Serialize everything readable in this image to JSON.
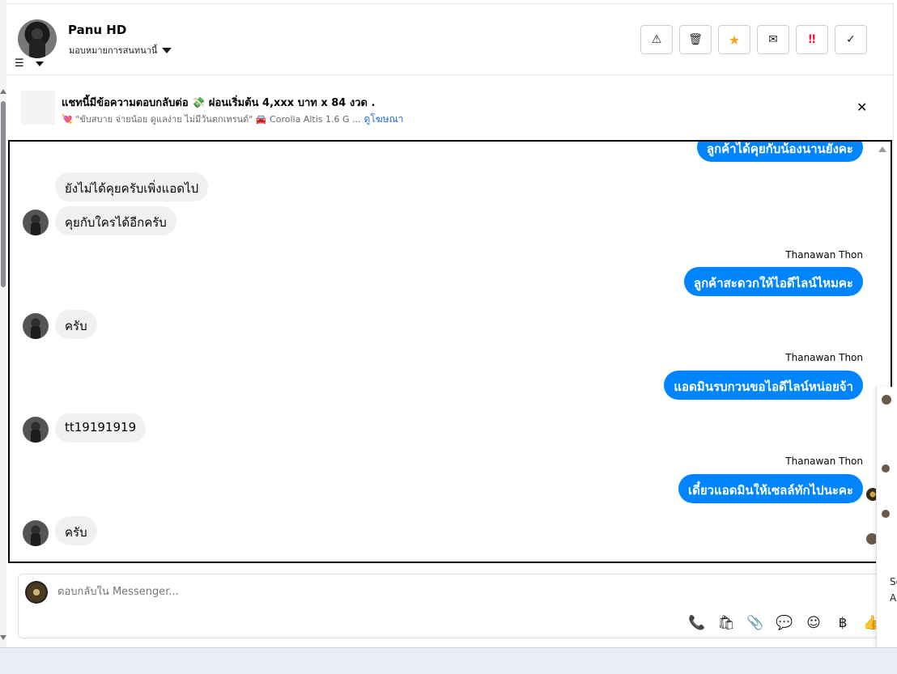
{
  "header": {
    "user_name": "Panu HD",
    "assign_label": "มอบหมายการสนทนานี้",
    "actions": [
      {
        "name": "report-button",
        "icon": "⚠"
      },
      {
        "name": "delete-button",
        "icon": "🗑"
      },
      {
        "name": "star-button",
        "icon": "★"
      },
      {
        "name": "mark-read-button",
        "icon": "✉"
      },
      {
        "name": "urgent-button",
        "icon": "‼"
      },
      {
        "name": "done-button",
        "icon": "✓"
      }
    ]
  },
  "ad": {
    "title": "แชทนี้มีข้อความตอบกลับต่อ 💸 ผ่อนเริ่มต้น 4,xxx บาท x 84 งวด .",
    "subtitle": "💘 \"ขับสบาย จ่ายน้อย ดูแลง่าย ไม่มีวันตกเทรนด์\" 🚘 Corolla Altis 1.6 G ...",
    "link_label": "ดูโฆษณา"
  },
  "messages": [
    {
      "dir": "out",
      "text": "ลูกค้าได้คุยกับน้องนานยังคะ"
    },
    {
      "dir": "in",
      "text": "ยังไม่ได้คุยครับเพิ่งแอดไป"
    },
    {
      "dir": "in",
      "text": "คุยกับใครได้อีกครับ"
    },
    {
      "dir": "sender",
      "text": "Thanawan Thon"
    },
    {
      "dir": "out",
      "text": "ลูกค้าสะดวกให้ไอดีไลน์ไหมคะ"
    },
    {
      "dir": "in",
      "text": "ครับ"
    },
    {
      "dir": "sender",
      "text": "Thanawan Thon"
    },
    {
      "dir": "out",
      "text": "แอดมินรบกวนขอไอดีไลน์หน่อยจ้า"
    },
    {
      "dir": "in",
      "text": "tt19191919"
    },
    {
      "dir": "sender",
      "text": "Thanawan Thon"
    },
    {
      "dir": "out",
      "text": "เดี๋ยวแอดมินให้เซลล์ทักไปนะคะ"
    },
    {
      "dir": "in",
      "text": "ครับ"
    }
  ],
  "composer": {
    "placeholder": "ตอบกลับใน Messenger...",
    "tools": [
      "📞",
      "🛍",
      "📎",
      "💬",
      "☺",
      "฿",
      "👍"
    ]
  },
  "side_popup": {
    "text_1": "Sc",
    "text_2": "A"
  }
}
